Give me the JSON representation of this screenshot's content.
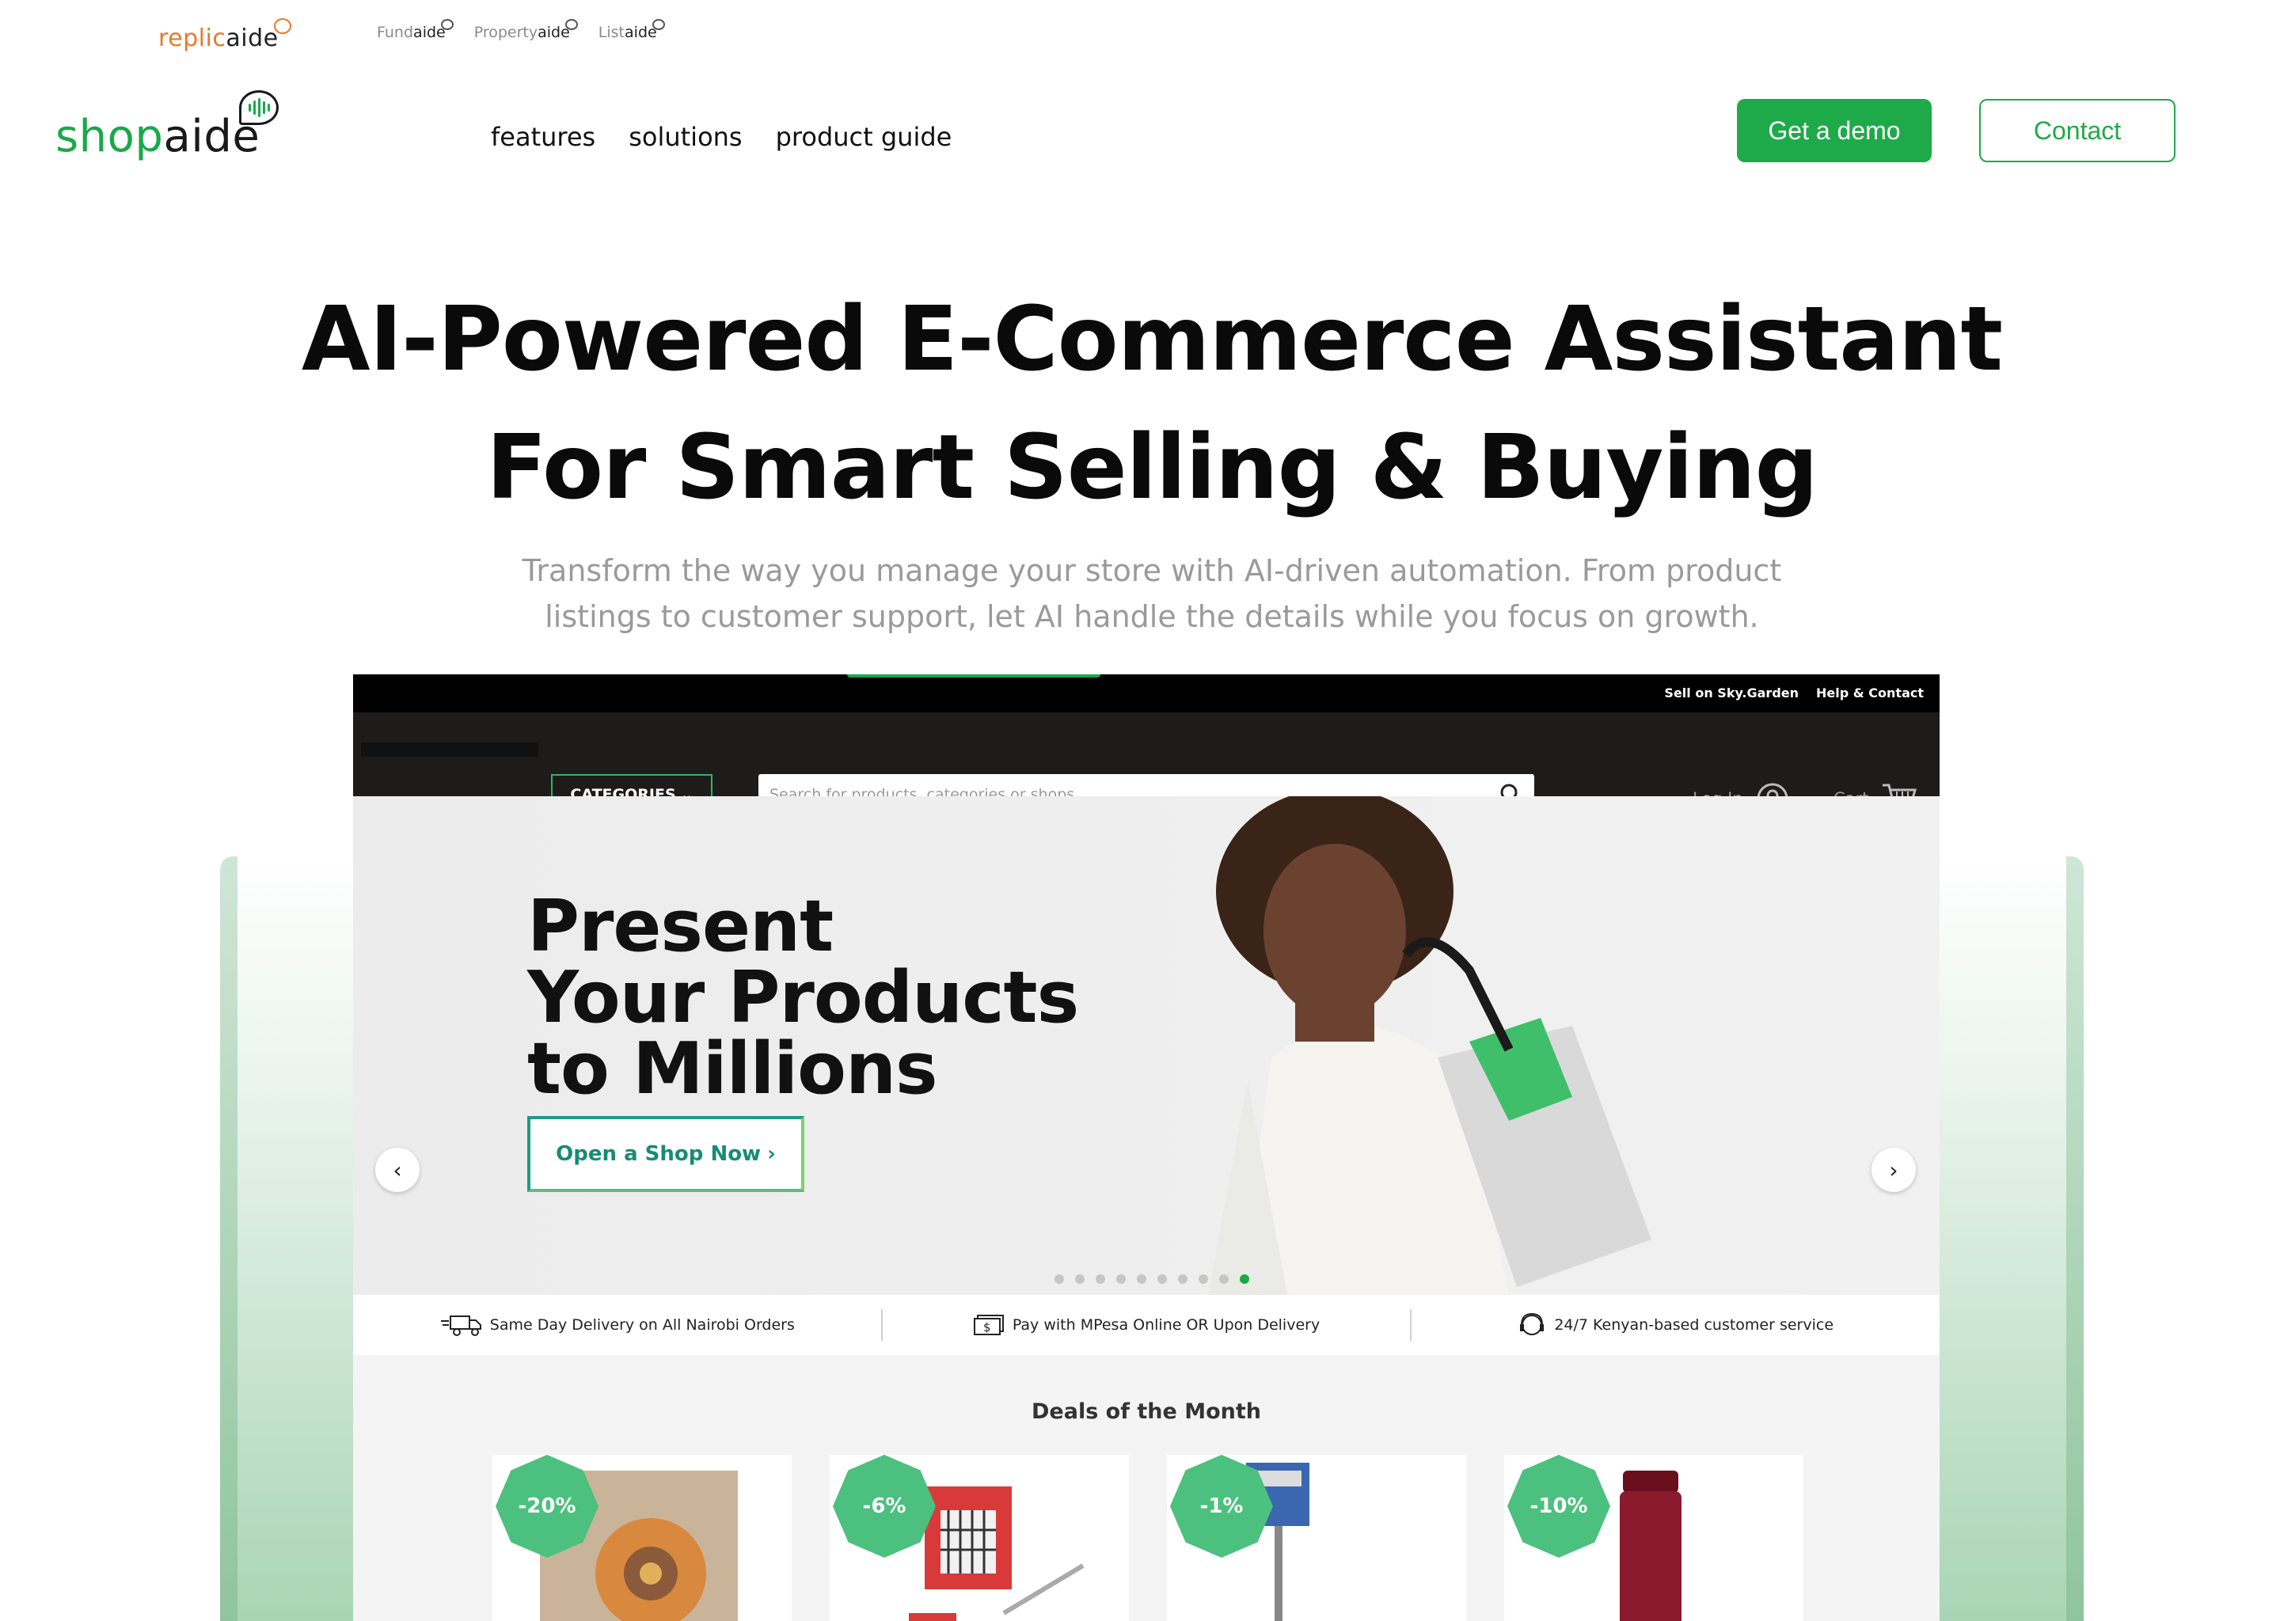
{
  "brand_strip": {
    "main": {
      "part1": "replic",
      "part2": "aide"
    },
    "sub_brands": [
      {
        "part1": "Fund",
        "part2": "aide"
      },
      {
        "part1": "Property",
        "part2": "aide"
      },
      {
        "part1": "List",
        "part2": "aide"
      }
    ]
  },
  "logo": {
    "part1": "shop",
    "part2": "aide"
  },
  "nav": {
    "items": [
      "features",
      "solutions",
      "product guide"
    ]
  },
  "actions": {
    "demo_label": "Get a demo",
    "contact_label": "Contact"
  },
  "hero": {
    "title_line1": "AI-Powered E-Commerce Assistant",
    "title_line2": "For Smart Selling & Buying",
    "subtitle": "Transform the way you manage your store with AI-driven automation. From product listings to customer support, let AI handle the details while you focus on growth."
  },
  "screenshot": {
    "top_links": [
      "Sell on Sky.Garden",
      "Help & Contact"
    ],
    "categories_label": "CATEGORIES",
    "search_placeholder": "Search for products, categories or shops",
    "login_label": "Log In",
    "cart_label": "Cart",
    "banner": {
      "line1": "Present",
      "line2": "Your Products",
      "line3": "to Millions",
      "cta": "Open a Shop Now"
    },
    "carousel": {
      "slide_count": 10,
      "active_slide": 10
    },
    "features": [
      "Same Day Delivery on All Nairobi Orders",
      "Pay with MPesa Online OR Upon Delivery",
      "24/7 Kenyan-based customer service"
    ],
    "deals_title": "Deals of the Month",
    "deals": [
      {
        "badge": "-20%"
      },
      {
        "badge": "-6%"
      },
      {
        "badge": "-1%"
      },
      {
        "badge": "-10%"
      }
    ]
  },
  "colors": {
    "brand_green": "#1faa4a",
    "replic_orange": "#e8792a"
  }
}
